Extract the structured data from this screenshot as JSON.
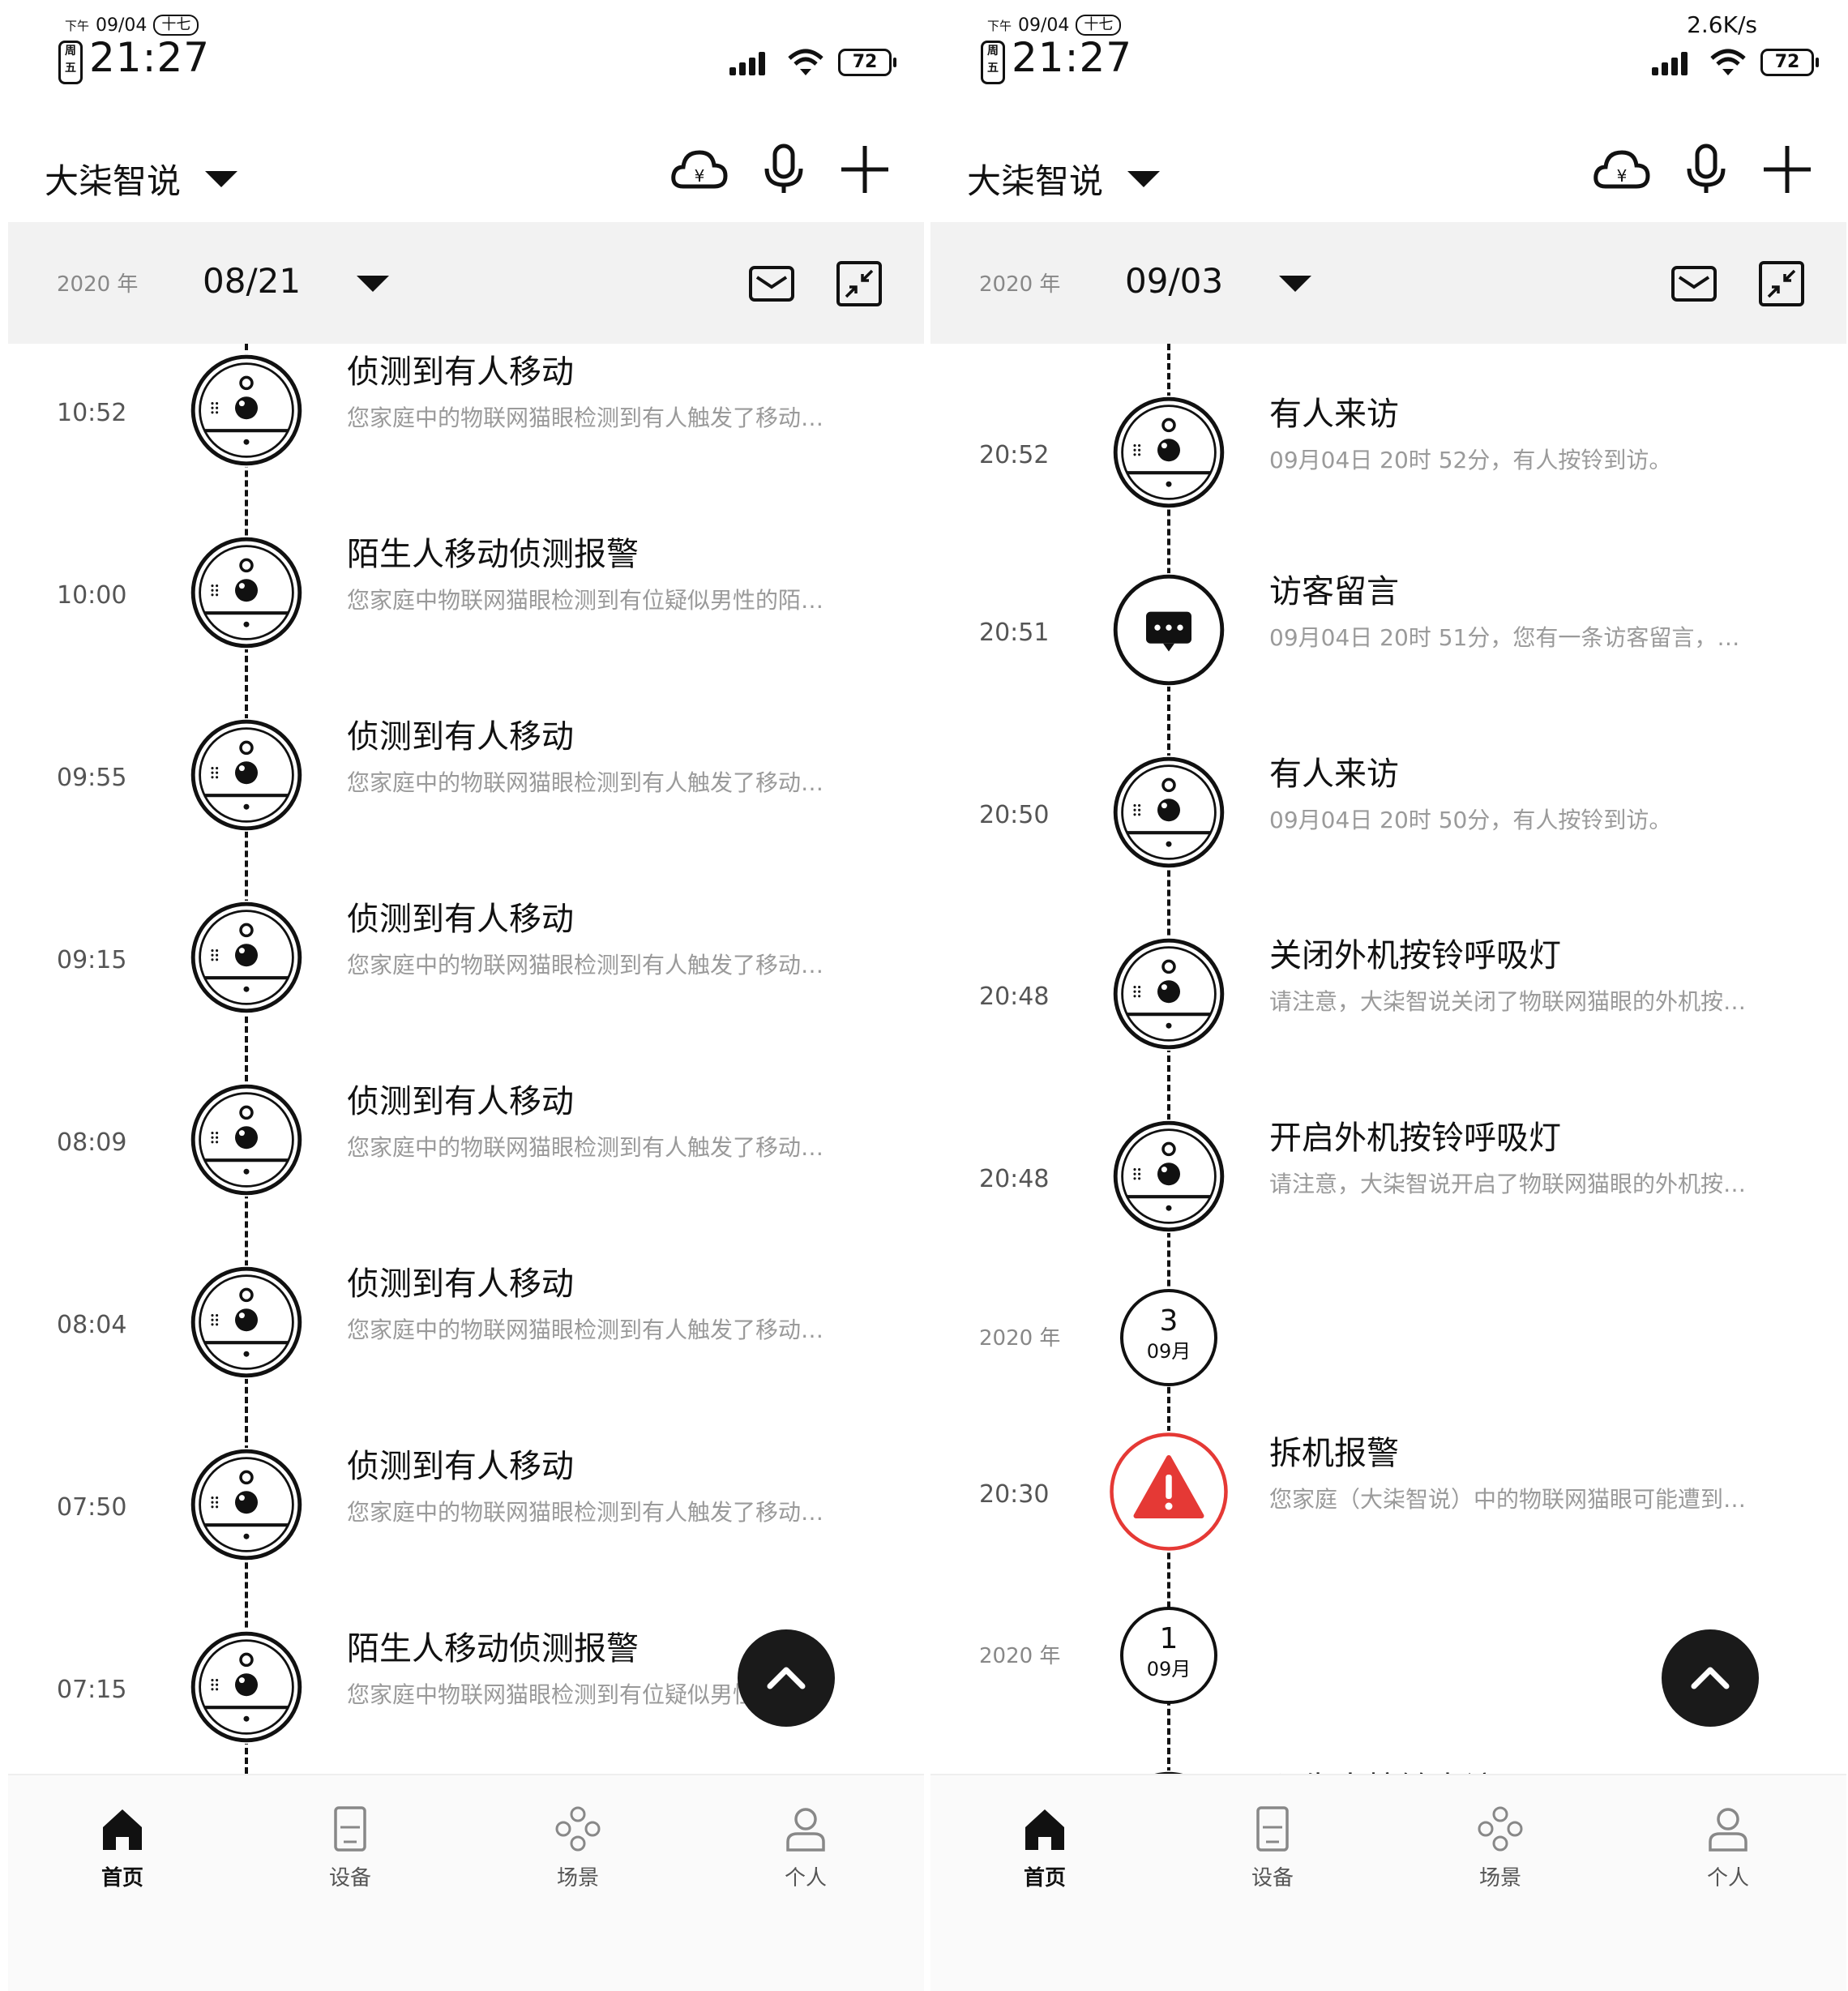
{
  "panels": [
    {
      "status": {
        "pm": "下午",
        "small_date": "09/04",
        "lunar": "十七",
        "weekday": "周五",
        "clock": "21:27",
        "speed": "",
        "battery": "72"
      },
      "app_title": "大柒智说",
      "datebar": {
        "year": "2020 年",
        "date": "08/21"
      },
      "events": [
        {
          "time": "10:52",
          "title": "侦测到有人移动",
          "desc": "您家庭中的物联网猫眼检测到有人触发了移动…",
          "icon": "cat-eye-device-icon"
        },
        {
          "time": "10:00",
          "title": "陌生人移动侦测报警",
          "desc": "您家庭中物联网猫眼检测到有位疑似男性的陌…",
          "icon": "cat-eye-device-icon"
        },
        {
          "time": "09:55",
          "title": "侦测到有人移动",
          "desc": "您家庭中的物联网猫眼检测到有人触发了移动…",
          "icon": "cat-eye-device-icon"
        },
        {
          "time": "09:15",
          "title": "侦测到有人移动",
          "desc": "您家庭中的物联网猫眼检测到有人触发了移动…",
          "icon": "cat-eye-device-icon"
        },
        {
          "time": "08:09",
          "title": "侦测到有人移动",
          "desc": "您家庭中的物联网猫眼检测到有人触发了移动…",
          "icon": "cat-eye-device-icon"
        },
        {
          "time": "08:04",
          "title": "侦测到有人移动",
          "desc": "您家庭中的物联网猫眼检测到有人触发了移动…",
          "icon": "cat-eye-device-icon"
        },
        {
          "time": "07:50",
          "title": "侦测到有人移动",
          "desc": "您家庭中的物联网猫眼检测到有人触发了移动…",
          "icon": "cat-eye-device-icon"
        },
        {
          "time": "07:15",
          "title": "陌生人移动侦测报警",
          "desc": "您家庭中物联网猫眼检测到有位疑似男性的陌…",
          "icon": "cat-eye-device-icon"
        }
      ],
      "date_markers": [],
      "tabs": [
        {
          "label": "首页",
          "icon": "home-icon"
        },
        {
          "label": "设备",
          "icon": "device-icon"
        },
        {
          "label": "场景",
          "icon": "scene-icon"
        },
        {
          "label": "个人",
          "icon": "person-icon"
        }
      ]
    },
    {
      "status": {
        "pm": "下午",
        "small_date": "09/04",
        "lunar": "十七",
        "weekday": "周五",
        "clock": "21:27",
        "speed": "2.6K/s",
        "battery": "72"
      },
      "app_title": "大柒智说",
      "datebar": {
        "year": "2020 年",
        "date": "09/03"
      },
      "events": [
        {
          "time": "20:52",
          "title": "有人来访",
          "desc": "09月04日 20时 52分，有人按铃到访。",
          "icon": "cat-eye-device-icon"
        },
        {
          "time": "20:51",
          "title": "访客留言",
          "desc": "09月04日 20时 51分，您有一条访客留言，…",
          "icon": "message-bubble-icon"
        },
        {
          "time": "20:50",
          "title": "有人来访",
          "desc": "09月04日 20时 50分，有人按铃到访。",
          "icon": "cat-eye-device-icon"
        },
        {
          "time": "20:48",
          "title": "关闭外机按铃呼吸灯",
          "desc": "请注意，大柒智说关闭了物联网猫眼的外机按…",
          "icon": "cat-eye-device-icon"
        },
        {
          "time": "20:48",
          "title": "开启外机按铃呼吸灯",
          "desc": "请注意，大柒智说开启了物联网猫眼的外机按…",
          "icon": "cat-eye-device-icon"
        },
        {
          "time": "20:30",
          "title": "拆机报警",
          "desc": "您家庭（大柒智说）中的物联网猫眼可能遭到…",
          "icon": "warning-icon"
        },
        {
          "time": "",
          "title": "陌生人按铃来访",
          "desc": "",
          "icon": "cat-eye-device-icon"
        }
      ],
      "date_markers": [
        {
          "year": "2020 年",
          "day": "3",
          "month": "09月"
        },
        {
          "year": "2020 年",
          "day": "1",
          "month": "09月"
        }
      ],
      "tabs": [
        {
          "label": "首页",
          "icon": "home-icon"
        },
        {
          "label": "设备",
          "icon": "device-icon"
        },
        {
          "label": "场景",
          "icon": "scene-icon"
        },
        {
          "label": "个人",
          "icon": "person-icon"
        }
      ]
    }
  ],
  "colors": {
    "accent": "#111111",
    "alert": "#e53935",
    "muted": "#9a9a9a",
    "datebar_bg": "#f2f2f2",
    "fab": "#1a1a1a"
  }
}
